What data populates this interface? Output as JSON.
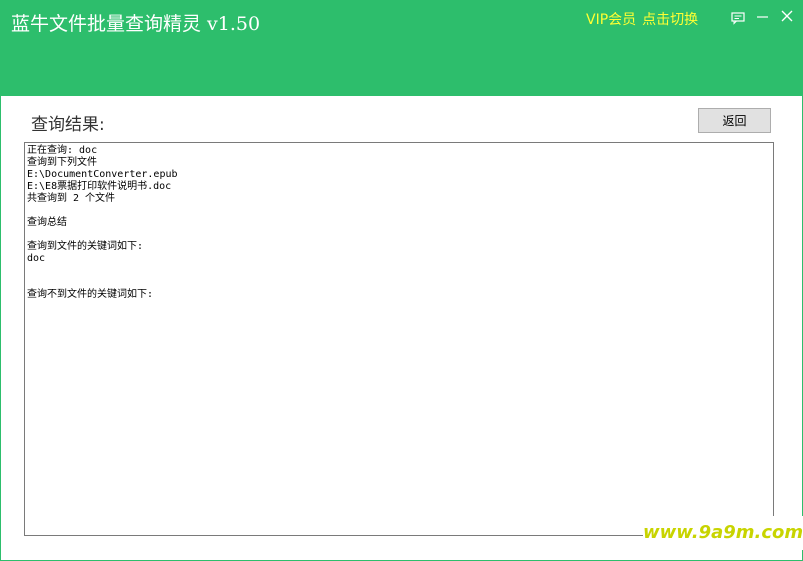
{
  "window": {
    "title": "蓝牛文件批量查询精灵 v1.50",
    "vip_label": "VIP会员",
    "switch_label": "点击切换",
    "accent_color": "#2dbe6c",
    "vip_color": "#ffff33"
  },
  "controls": {
    "feedback_icon": "feedback-icon",
    "minimize_icon": "minimize-icon",
    "close_icon": "close-icon"
  },
  "main": {
    "section_title": "查询结果:",
    "back_button_label": "返回",
    "results": [
      "正在查询: doc",
      "查询到下列文件",
      "E:\\DocumentConverter.epub",
      "E:\\E8票据打印软件说明书.doc",
      "共查询到 2 个文件",
      "",
      "查询总结",
      "",
      "查询到文件的关键词如下:",
      "doc",
      "",
      "",
      "查询不到文件的关键词如下:"
    ]
  },
  "watermark": {
    "text": "www.9a9m.com"
  }
}
